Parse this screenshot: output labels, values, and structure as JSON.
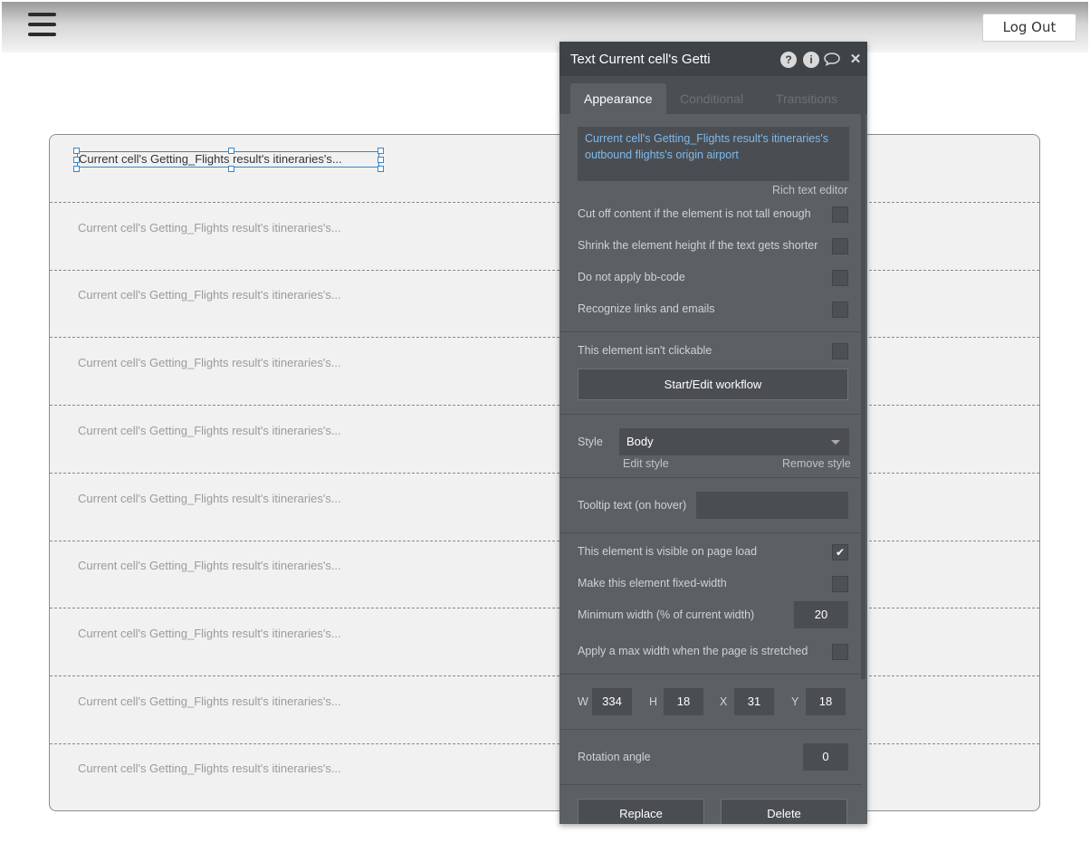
{
  "header": {
    "logout_label": "Log Out"
  },
  "list": {
    "cells": [
      "Current cell's Getting_Flights result's itineraries's...",
      "Current cell's Getting_Flights result's itineraries's...",
      "Current cell's Getting_Flights result's itineraries's...",
      "Current cell's Getting_Flights result's itineraries's...",
      "Current cell's Getting_Flights result's itineraries's...",
      "Current cell's Getting_Flights result's itineraries's...",
      "Current cell's Getting_Flights result's itineraries's...",
      "Current cell's Getting_Flights result's itineraries's...",
      "Current cell's Getting_Flights result's itineraries's...",
      "Current cell's Getting_Flights result's itineraries's..."
    ]
  },
  "panel": {
    "title": "Text Current cell's Getti",
    "icons": [
      "help-icon",
      "info-icon",
      "comment-icon",
      "close-icon"
    ],
    "tabs": [
      "Appearance",
      "Conditional",
      "Transitions"
    ],
    "content_text": "Current cell's Getting_Flights result's itineraries's outbound flights's origin airport",
    "rich_text_label": "Rich text editor",
    "options": {
      "cut_off": "Cut off content if the element is not tall enough",
      "shrink": "Shrink the element height if the text gets shorter",
      "no_bbcode": "Do not apply bb-code",
      "links": "Recognize links and emails",
      "not_clickable": "This element isn't clickable"
    },
    "workflow_button": "Start/Edit workflow",
    "style": {
      "label": "Style",
      "value": "Body",
      "edit": "Edit style",
      "remove": "Remove style"
    },
    "tooltip_label": "Tooltip text (on hover)",
    "visible_label": "This element is visible on page load",
    "fixed_width_label": "Make this element fixed-width",
    "min_width_label": "Minimum width (% of current width)",
    "min_width_value": "20",
    "max_width_label": "Apply a max width when the page is stretched",
    "dims": {
      "w_label": "W",
      "w": "334",
      "h_label": "H",
      "h": "18",
      "x_label": "X",
      "x": "31",
      "y_label": "Y",
      "y": "18"
    },
    "rotation_label": "Rotation angle",
    "rotation_value": "0",
    "replace_button": "Replace",
    "delete_button": "Delete"
  }
}
